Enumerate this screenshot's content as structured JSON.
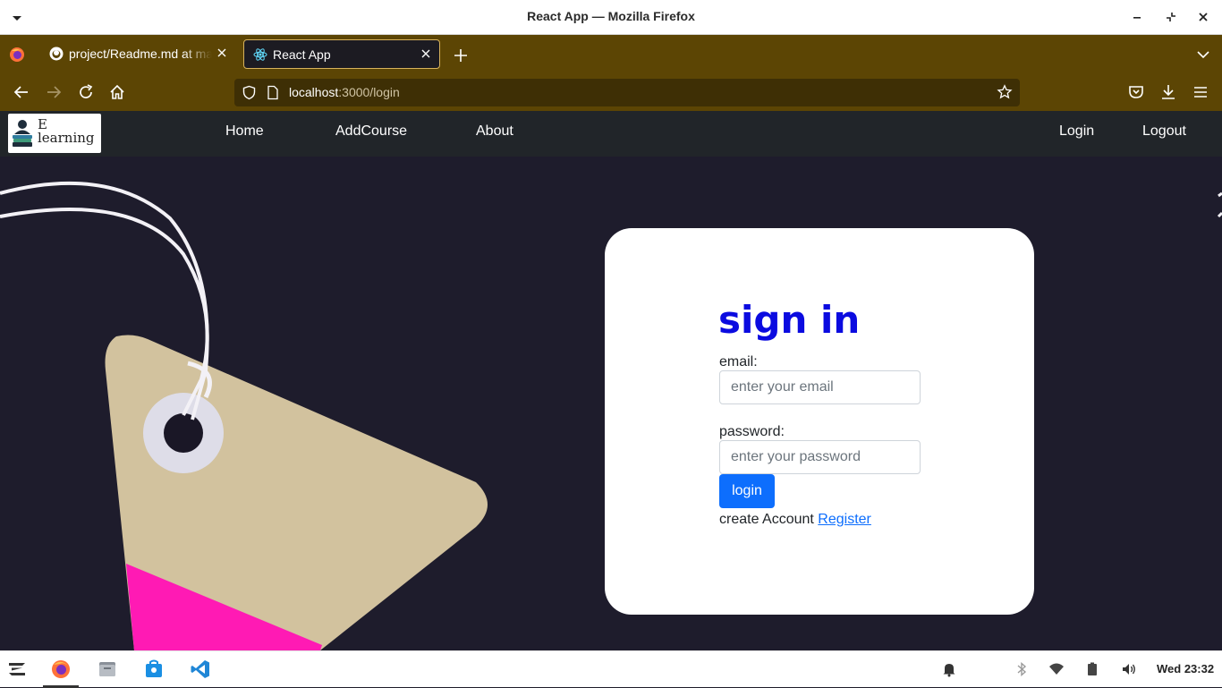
{
  "window": {
    "title": "React App — Mozilla Firefox"
  },
  "tabs": [
    {
      "label": "project/Readme.md at master",
      "active": false
    },
    {
      "label": "React App",
      "active": true
    }
  ],
  "urlbar": {
    "host": "localhost",
    "path": ":3000/login"
  },
  "app_nav": {
    "brand_line1": "E",
    "brand_line2": "learning",
    "links": [
      "Home",
      "AddCourse",
      "About"
    ],
    "right_links": [
      "Login",
      "Logout"
    ]
  },
  "login_form": {
    "heading": "sign in",
    "email_label": "email:",
    "email_placeholder": "enter your email",
    "password_label": "password:",
    "password_placeholder": "enter your password",
    "submit_label": "login",
    "create_text": "create Account",
    "register_link": "Register"
  },
  "taskbar": {
    "clock": "Wed 23:32"
  },
  "colors": {
    "firefox_theme": "#5c4504",
    "heading": "#0b0be0",
    "button": "#0d6efd",
    "navbar": "#212529"
  }
}
